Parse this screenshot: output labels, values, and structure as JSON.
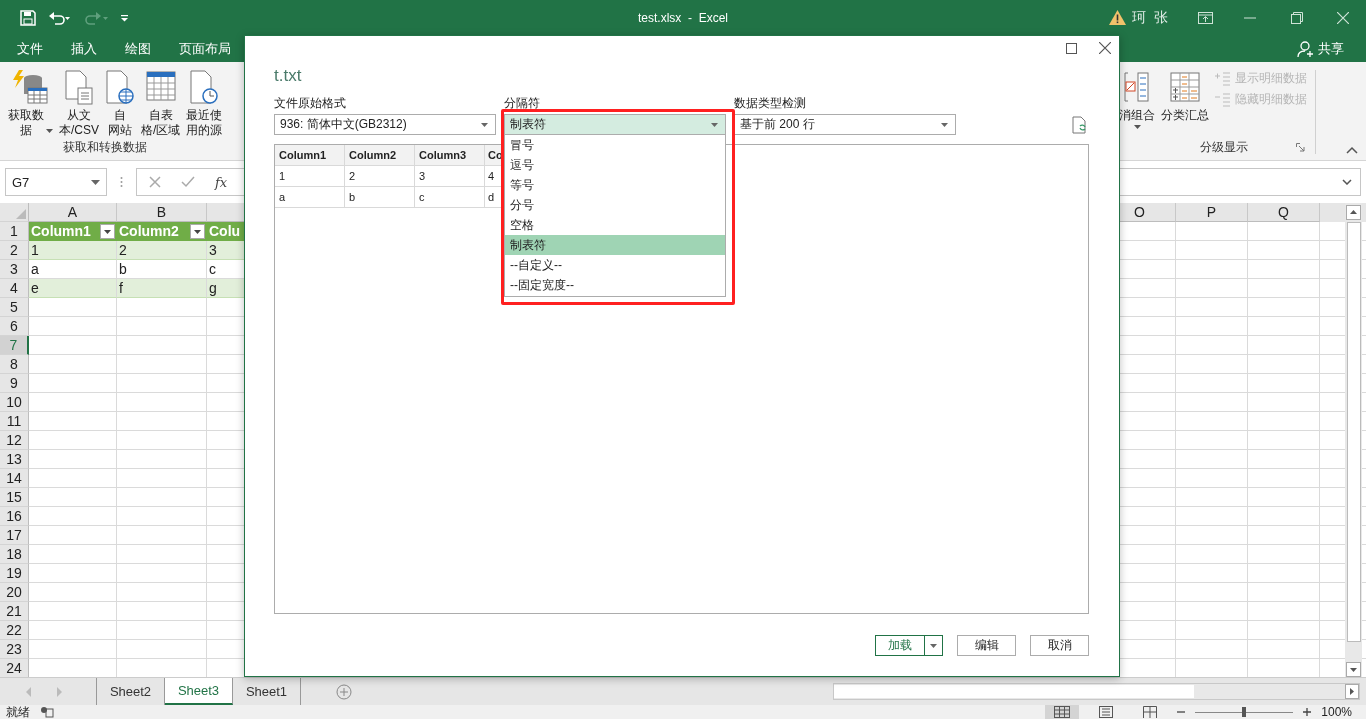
{
  "title_bar": {
    "title": "test.xlsx  -  Excel",
    "user": "珂 张"
  },
  "menu_tabs": [
    {
      "label": "文件"
    },
    {
      "label": "插入"
    },
    {
      "label": "绘图"
    },
    {
      "label": "页面布局"
    }
  ],
  "share": "共享",
  "ribbon": {
    "left_group": {
      "label": "获取和转换数据",
      "buttons": [
        {
          "lines": [
            "获取数",
            "据"
          ],
          "kind": "database",
          "has_menu": true
        },
        {
          "lines": [
            "从文",
            "本/CSV"
          ],
          "kind": "text-file",
          "has_menu": false
        },
        {
          "lines": [
            "自",
            "网站"
          ],
          "kind": "web",
          "has_menu": false
        },
        {
          "lines": [
            "自表",
            "格/区域"
          ],
          "kind": "table",
          "has_menu": false
        },
        {
          "lines": [
            "最近使",
            "用的源"
          ],
          "kind": "recent",
          "has_menu": false
        }
      ]
    },
    "right_group": {
      "label": "分级显示",
      "buttons": [
        {
          "lines": [
            "消组合"
          ],
          "kind": "ungroup",
          "has_menu": true
        },
        {
          "lines": [
            "分类汇总"
          ],
          "kind": "subtotal",
          "has_menu": false
        }
      ],
      "small_buttons": [
        {
          "label": "显示明细数据",
          "disabled": true,
          "kind": "show"
        },
        {
          "label": "隐藏明细数据",
          "disabled": true,
          "kind": "hide"
        }
      ]
    }
  },
  "formula_bar": {
    "name_box": "G7",
    "function_symbol": "fx"
  },
  "sheet": {
    "columns": [
      "A",
      "B",
      "O",
      "P",
      "Q"
    ],
    "rows": [
      {
        "number": "1",
        "selected": false,
        "kind": "header",
        "cells": [
          "Column1",
          "Column2",
          "Colu"
        ]
      },
      {
        "number": "2",
        "selected": false,
        "kind": "band",
        "cells": [
          "1",
          "2",
          "3"
        ]
      },
      {
        "number": "3",
        "selected": false,
        "kind": "plain",
        "cells": [
          "a",
          "b",
          "c"
        ]
      },
      {
        "number": "4",
        "selected": false,
        "kind": "band",
        "cells": [
          "e",
          "f",
          "g"
        ]
      },
      {
        "number": "5",
        "selected": false
      },
      {
        "number": "6",
        "selected": false
      },
      {
        "number": "7",
        "selected": true
      },
      {
        "number": "8",
        "selected": false
      },
      {
        "number": "9",
        "selected": false
      },
      {
        "number": "10",
        "selected": false
      },
      {
        "number": "11",
        "selected": false
      },
      {
        "number": "12",
        "selected": false
      },
      {
        "number": "13",
        "selected": false
      },
      {
        "number": "14",
        "selected": false
      },
      {
        "number": "15",
        "selected": false
      },
      {
        "number": "16",
        "selected": false
      },
      {
        "number": "17",
        "selected": false
      },
      {
        "number": "18",
        "selected": false
      },
      {
        "number": "19",
        "selected": false
      },
      {
        "number": "20",
        "selected": false
      },
      {
        "number": "21",
        "selected": false
      },
      {
        "number": "22",
        "selected": false
      },
      {
        "number": "23",
        "selected": false
      },
      {
        "number": "24",
        "selected": false
      }
    ]
  },
  "sheet_tabs": [
    {
      "label": "Sheet2",
      "selected": false
    },
    {
      "label": "Sheet3",
      "selected": true
    },
    {
      "label": "Sheet1",
      "selected": false
    }
  ],
  "status_bar": {
    "status": "就绪",
    "zoom": "100%",
    "zoom_slider": {
      "level": 0.5
    }
  },
  "dialog": {
    "title": "t.txt",
    "fields": [
      {
        "label": "文件原始格式",
        "value": "936: 简体中文(GB2312)",
        "expanded": false
      },
      {
        "label": "分隔符",
        "value": "制表符",
        "expanded": true,
        "options": [
          {
            "label": "冒号",
            "selected": false
          },
          {
            "label": "逗号",
            "selected": false
          },
          {
            "label": "等号",
            "selected": false
          },
          {
            "label": "分号",
            "selected": false
          },
          {
            "label": "空格",
            "selected": false
          },
          {
            "label": "制表符",
            "selected": true
          },
          {
            "label": "--自定义--",
            "selected": false
          },
          {
            "label": "--固定宽度--",
            "selected": false
          }
        ]
      },
      {
        "label": "数据类型检测",
        "value": "基于前 200 行",
        "expanded": false
      }
    ],
    "preview": {
      "columns": [
        "Column1",
        "Column2",
        "Column3",
        "Co"
      ],
      "rows": [
        [
          "1",
          "2",
          "3",
          "4"
        ],
        [
          "a",
          "b",
          "c",
          "d"
        ]
      ]
    },
    "buttons": [
      {
        "label": "加载",
        "kind": "split"
      },
      {
        "label": "编辑",
        "kind": "plain"
      },
      {
        "label": "取消",
        "kind": "plain"
      }
    ]
  }
}
